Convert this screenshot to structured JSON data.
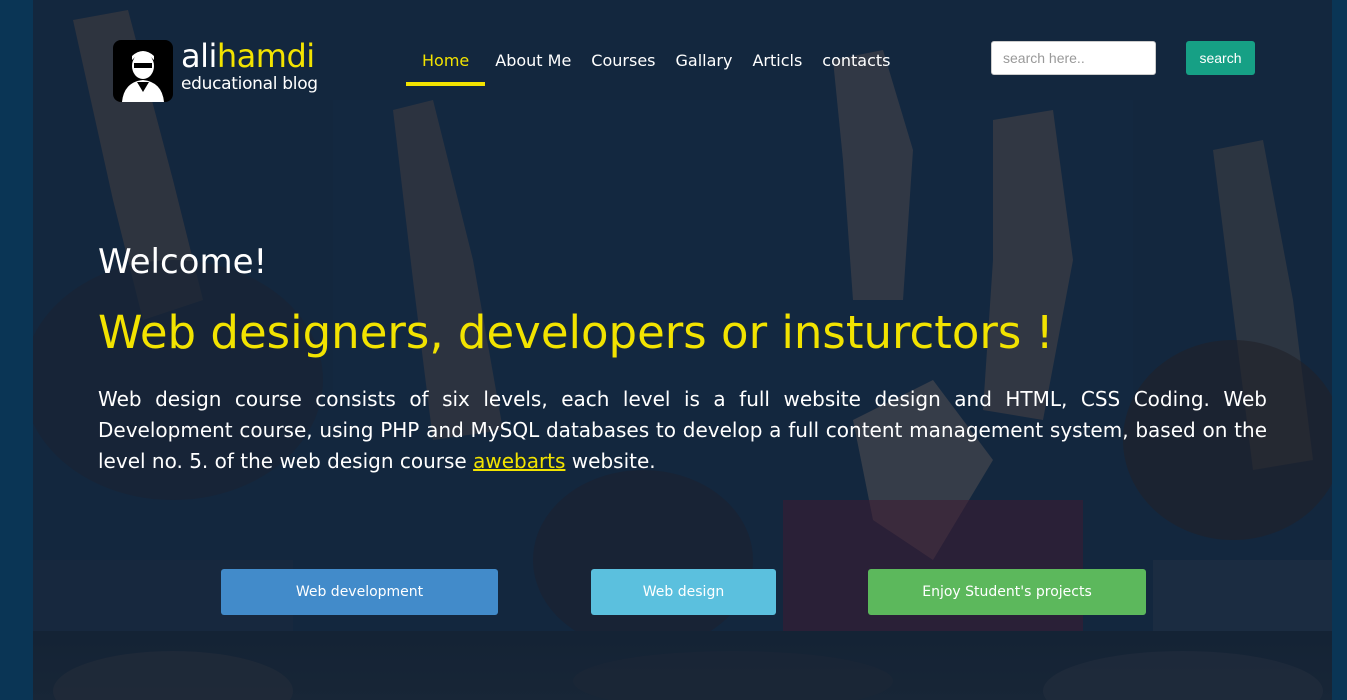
{
  "logo": {
    "name_plain": "ali",
    "name_accent": "hamdi",
    "subtitle": "educational blog",
    "icon": "portrait-icon"
  },
  "nav": {
    "items": [
      {
        "label": "Home",
        "active": true
      },
      {
        "label": "About Me",
        "active": false
      },
      {
        "label": "Courses",
        "active": false
      },
      {
        "label": "Gallary",
        "active": false
      },
      {
        "label": "Articls",
        "active": false
      },
      {
        "label": "contacts",
        "active": false
      }
    ]
  },
  "search": {
    "placeholder": "search here..",
    "value": "",
    "button_label": "search"
  },
  "hero": {
    "welcome": "Welcome!",
    "headline": "Web designers, developers or insturctors !",
    "description_before": "Web design course consists of six levels, each level is a full website design and HTML, CSS Coding. Web Development course, using PHP and MySQL databases to develop a full content management system, based on the level no. 5. of the web design course ",
    "description_link": "awebarts",
    "description_after": " website."
  },
  "buttons": {
    "web_development": "Web development",
    "web_design": "Web design",
    "student_projects": "Enjoy Student's projects"
  },
  "colors": {
    "accent_yellow": "#f2e300",
    "search_button": "#16a085",
    "btn_primary": "#428bca",
    "btn_info": "#5bc0de",
    "btn_success": "#5cb85c",
    "page_background": "#0a3555"
  }
}
